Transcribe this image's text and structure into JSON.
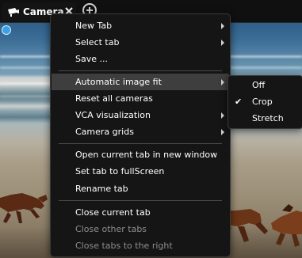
{
  "tab": {
    "label": "Camera",
    "icon": "camera-icon",
    "close_icon": "close-icon"
  },
  "add_tab": {
    "icon": "plus-icon"
  },
  "menu": {
    "items": [
      {
        "label": "New Tab",
        "has_submenu": true,
        "enabled": true
      },
      {
        "label": "Select tab",
        "has_submenu": true,
        "enabled": true
      },
      {
        "label": "Save ...",
        "has_submenu": false,
        "enabled": true
      },
      {
        "label": "Automatic image fit",
        "has_submenu": true,
        "enabled": true,
        "highlighted": true
      },
      {
        "label": "Reset all cameras",
        "has_submenu": false,
        "enabled": true
      },
      {
        "label": "VCA visualization",
        "has_submenu": true,
        "enabled": true
      },
      {
        "label": "Camera grids",
        "has_submenu": true,
        "enabled": true
      },
      {
        "label": "Open current tab in new window",
        "has_submenu": false,
        "enabled": true
      },
      {
        "label": "Set tab to fullScreen",
        "has_submenu": false,
        "enabled": true
      },
      {
        "label": "Rename tab",
        "has_submenu": false,
        "enabled": true
      },
      {
        "label": "Close current tab",
        "has_submenu": false,
        "enabled": true
      },
      {
        "label": "Close other tabs",
        "has_submenu": false,
        "enabled": false
      },
      {
        "label": "Close tabs to the right",
        "has_submenu": false,
        "enabled": false
      }
    ]
  },
  "submenu": {
    "items": [
      {
        "label": "Off",
        "checked": false
      },
      {
        "label": "Crop",
        "checked": true
      },
      {
        "label": "Stretch",
        "checked": false
      }
    ],
    "check_glyph": "✔"
  },
  "colors": {
    "menu_bg": "#151515",
    "highlight": "#3e3e3e",
    "disabled_text": "#8e8e8e",
    "status_dot": "#3aa0e8"
  }
}
